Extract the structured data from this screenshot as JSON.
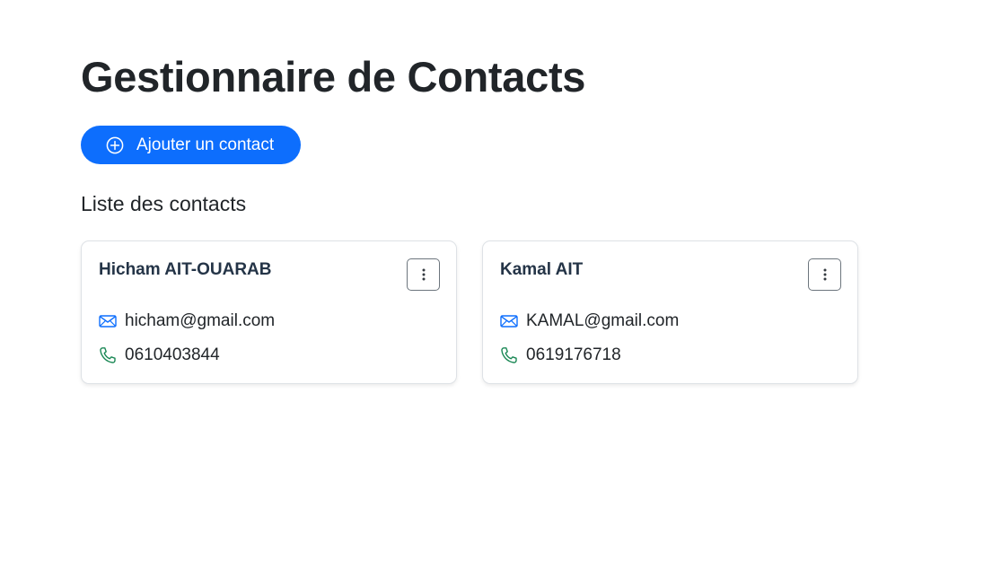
{
  "header": {
    "title": "Gestionnaire de Contacts"
  },
  "actions": {
    "add_label": "Ajouter un contact",
    "add_icon": "plus-circle-icon"
  },
  "list": {
    "title": "Liste des contacts",
    "contacts": [
      {
        "name": "Hicham AIT-OUARAB",
        "email": "hicham@gmail.com",
        "phone": "0610403844"
      },
      {
        "name": "Kamal AIT",
        "email": "KAMAL@gmail.com",
        "phone": "0619176718"
      }
    ]
  },
  "icons": {
    "email": "envelope-icon",
    "phone": "telephone-icon",
    "menu": "three-dots-vertical-icon"
  },
  "colors": {
    "primary": "#0d6efd",
    "email_icon": "#0d6efd",
    "phone_icon": "#198754",
    "text": "#212529"
  }
}
